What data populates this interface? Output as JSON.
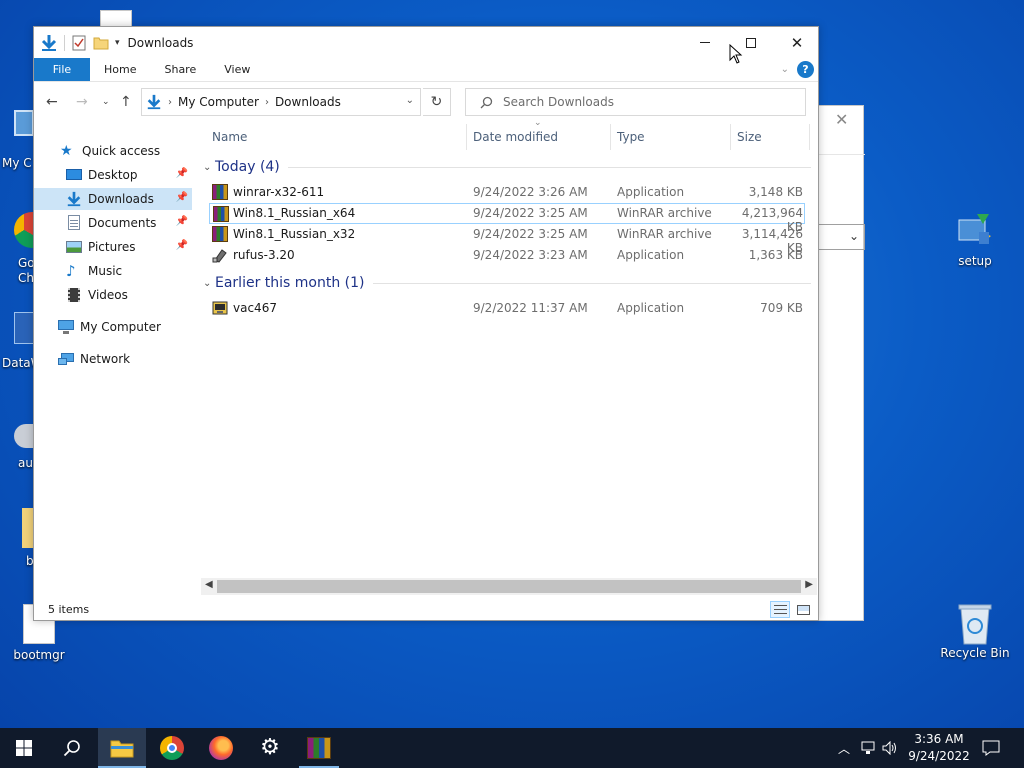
{
  "window": {
    "title": "Downloads",
    "ribbon_tabs": [
      "File",
      "Home",
      "Share",
      "View"
    ],
    "help_label": "?"
  },
  "address": {
    "segments": [
      "My Computer",
      "Downloads"
    ]
  },
  "search": {
    "placeholder": "Search Downloads"
  },
  "nav_pane": {
    "items": [
      {
        "label": "Quick access",
        "icon": "star-icon"
      },
      {
        "label": "Desktop",
        "icon": "desktop-icon",
        "pinned": true
      },
      {
        "label": "Downloads",
        "icon": "download-arrow-icon",
        "pinned": true,
        "selected": true
      },
      {
        "label": "Documents",
        "icon": "document-icon",
        "pinned": true
      },
      {
        "label": "Pictures",
        "icon": "picture-icon",
        "pinned": true
      },
      {
        "label": "Music",
        "icon": "music-note-icon"
      },
      {
        "label": "Videos",
        "icon": "film-icon"
      },
      {
        "label": "My Computer",
        "icon": "computer-icon"
      },
      {
        "label": "Network",
        "icon": "network-icon"
      }
    ]
  },
  "columns": [
    "Name",
    "Date modified",
    "Type",
    "Size"
  ],
  "groups": [
    {
      "label": "Today (4)",
      "files": [
        {
          "name": "winrar-x32-611",
          "date": "9/24/2022 3:26 AM",
          "type": "Application",
          "size": "3,148 KB",
          "icon": "winrar-icon"
        },
        {
          "name": "Win8.1_Russian_x64",
          "date": "9/24/2022 3:25 AM",
          "type": "WinRAR archive",
          "size": "4,213,964 KB",
          "icon": "winrar-icon",
          "selected": true
        },
        {
          "name": "Win8.1_Russian_x32",
          "date": "9/24/2022 3:25 AM",
          "type": "WinRAR archive",
          "size": "3,114,426 KB",
          "icon": "winrar-icon"
        },
        {
          "name": "rufus-3.20",
          "date": "9/24/2022 3:23 AM",
          "type": "Application",
          "size": "1,363 KB",
          "icon": "usb-drive-icon"
        }
      ]
    },
    {
      "label": "Earlier this month (1)",
      "files": [
        {
          "name": "vac467",
          "date": "9/2/2022 11:37 AM",
          "type": "Application",
          "size": "709 KB",
          "icon": "installer-icon"
        }
      ]
    }
  ],
  "status": {
    "item_count": "5 items"
  },
  "desktop": {
    "icons": [
      {
        "label": "setup"
      },
      {
        "label": "Recycle Bin"
      },
      {
        "label": "bootmgr"
      }
    ],
    "partial_labels": [
      "My C",
      "Go",
      "Ch",
      "DataW",
      "au",
      "b"
    ]
  },
  "taskbar": {
    "time": "3:36 AM",
    "date": "9/24/2022"
  },
  "colors": {
    "accent": "#1979ca",
    "selection": "#cce4f7",
    "group_header": "#1e3287",
    "taskbar": "#101a2b"
  }
}
